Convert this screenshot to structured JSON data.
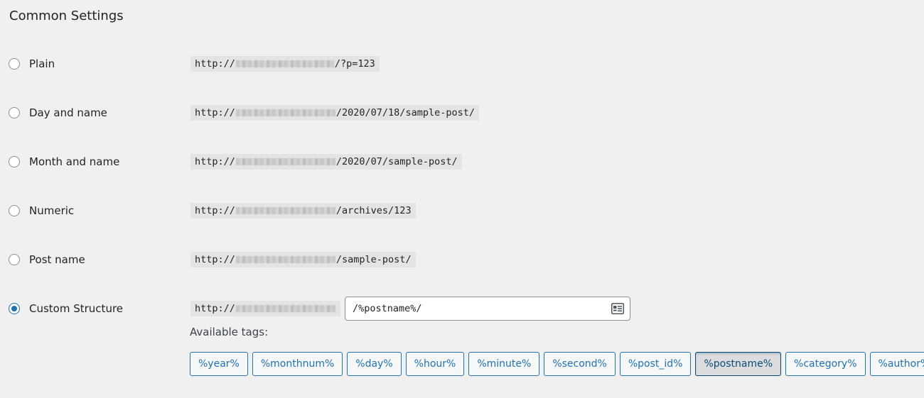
{
  "section": {
    "title": "Common Settings"
  },
  "options": [
    {
      "id": "plain",
      "label": "Plain",
      "prefix": "http://",
      "suffix": "/?p=123",
      "checked": false
    },
    {
      "id": "day-and-name",
      "label": "Day and name",
      "prefix": "http://",
      "suffix": "/2020/07/18/sample-post/",
      "checked": false
    },
    {
      "id": "month-and-name",
      "label": "Month and name",
      "prefix": "http://",
      "suffix": "/2020/07/sample-post/",
      "checked": false
    },
    {
      "id": "numeric",
      "label": "Numeric",
      "prefix": "http://",
      "suffix": "/archives/123",
      "checked": false
    },
    {
      "id": "post-name",
      "label": "Post name",
      "prefix": "http://",
      "suffix": "/sample-post/",
      "checked": false
    },
    {
      "id": "custom-structure",
      "label": "Custom Structure",
      "prefix": "http://",
      "checked": true
    }
  ],
  "custom_input": {
    "value": "/%postname%/"
  },
  "available_tags": {
    "label": "Available tags:",
    "tags": [
      "%year%",
      "%monthnum%",
      "%day%",
      "%hour%",
      "%minute%",
      "%second%",
      "%post_id%",
      "%postname%",
      "%category%",
      "%author%"
    ],
    "active": "%postname%"
  },
  "icons": {
    "input": "contact-card-icon",
    "radio": "radio-dot-icon"
  },
  "colors": {
    "accent": "#2271b1",
    "background": "#f0f0f1",
    "code_bg": "#e4e4e4"
  }
}
